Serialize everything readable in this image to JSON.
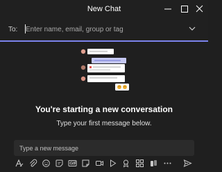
{
  "window": {
    "title": "New Chat"
  },
  "to_field": {
    "label": "To:",
    "placeholder": "Enter name, email, group or tag"
  },
  "empty_state": {
    "heading": "You're starting a new conversation",
    "subtitle": "Type your first message below."
  },
  "compose": {
    "placeholder": "Type a new message"
  },
  "toolbar": {
    "icons": [
      "format-icon",
      "attach-icon",
      "emoji-icon",
      "sticker-icon",
      "gif-icon",
      "stickers-icon",
      "meet-now-icon",
      "stream-icon",
      "praise-icon",
      "apps-icon",
      "more-icon",
      "send-icon"
    ]
  },
  "colors": {
    "accent": "#7b83eb",
    "background": "#1f1f1f",
    "titlebar": "#202020",
    "compose_bg": "#2b2b2b"
  }
}
